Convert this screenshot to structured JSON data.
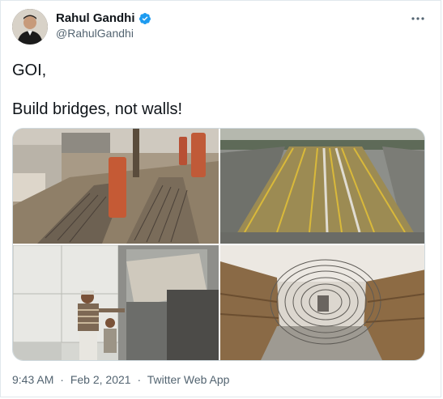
{
  "author": {
    "name": "Rahul Gandhi",
    "handle": "@RahulGandhi",
    "verified": true,
    "avatar_icon": "profile-photo"
  },
  "menu_icon": "more-horizontal-icon",
  "tweet": {
    "line1": "GOI,",
    "line2": "Build bridges, not walls!"
  },
  "media": [
    {
      "name": "road-trench-with-iron-spikes-photo"
    },
    {
      "name": "barricade-rows-aerial-photo"
    },
    {
      "name": "concrete-wall-construction-photo"
    },
    {
      "name": "razor-wire-barricade-photo"
    }
  ],
  "footer": {
    "time": "9:43 AM",
    "date": "Feb 2, 2021",
    "source": "Twitter Web App",
    "separator": "·"
  },
  "colors": {
    "verified_badge": "#1d9bf0",
    "secondary_text": "#536471",
    "border": "#cfd9de"
  }
}
